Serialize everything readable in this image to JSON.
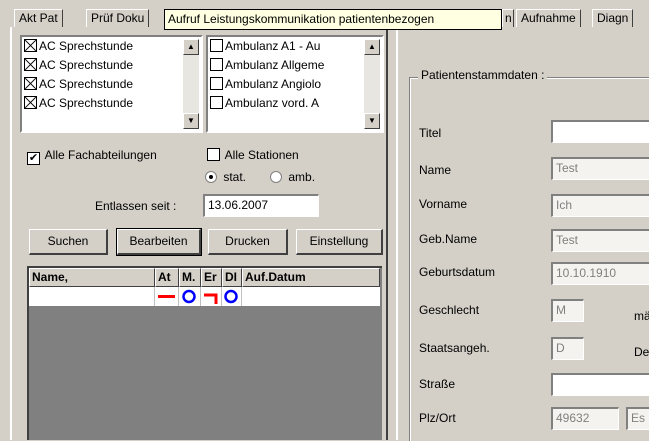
{
  "tabs": [
    {
      "label": "Akt Pat"
    },
    {
      "label": "Prüf Doku"
    },
    {
      "label": "n"
    },
    {
      "label": "Aufnahme"
    },
    {
      "label": "Diagn"
    }
  ],
  "tooltip": "Aufruf Leistungskommunikation patientenbezogen",
  "list_left": [
    {
      "label": "AC Sprechstunde",
      "checked": true
    },
    {
      "label": "AC Sprechstunde",
      "checked": true
    },
    {
      "label": "AC Sprechstunde",
      "checked": true
    },
    {
      "label": "AC Sprechstunde",
      "checked": true
    }
  ],
  "list_right": [
    {
      "label": "Ambulanz A1 - Au",
      "checked": false
    },
    {
      "label": "Ambulanz Allgeme",
      "checked": false
    },
    {
      "label": "Ambulanz Angiolo",
      "checked": false
    },
    {
      "label": "Ambulanz vord. A",
      "checked": false
    }
  ],
  "filters": {
    "alle_fachabteilungen": "Alle Fachabteilungen",
    "alle_stationen": "Alle Stationen",
    "stat": "stat.",
    "amb": "amb.",
    "entlassen_label": "Entlassen seit :",
    "entlassen_value": "13.06.2007"
  },
  "buttons": {
    "suchen": "Suchen",
    "bearbeiten": "Bearbeiten",
    "drucken": "Drucken",
    "einstellung": "Einstellung"
  },
  "grid": {
    "columns": [
      "Name,",
      "At",
      "M.",
      "Er",
      "DI",
      "Auf.Datum"
    ]
  },
  "stammdaten": {
    "title": "Patientenstammdaten :",
    "fields": [
      {
        "label": "Titel",
        "value": ""
      },
      {
        "label": "Name",
        "value": "Test"
      },
      {
        "label": "Vorname",
        "value": "Ich"
      },
      {
        "label": "Geb.Name",
        "value": "Test"
      },
      {
        "label": "Geburtsdatum",
        "value": "10.10.1910"
      },
      {
        "label": "Geschlecht",
        "value": "M"
      },
      {
        "label": "Staatsangeh.",
        "value": "D"
      },
      {
        "label": "Straße",
        "value": ""
      },
      {
        "label": "Plz/Ort",
        "value": "49632"
      }
    ],
    "geschlecht_extra": "mä",
    "staat_extra": "De",
    "ort_value": "Es"
  }
}
